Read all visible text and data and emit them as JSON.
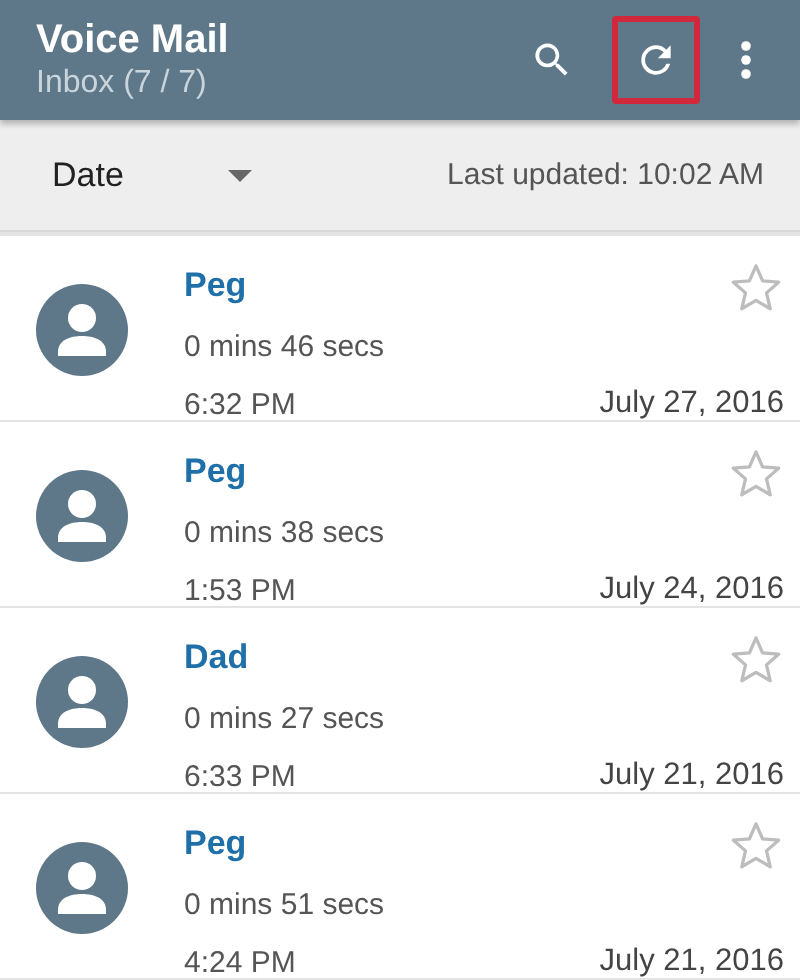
{
  "app_bar": {
    "title": "Voice Mail",
    "subtitle": "Inbox (7 / 7)",
    "actions": [
      {
        "kind": "search",
        "highlighted": false
      },
      {
        "kind": "refresh",
        "highlighted": true
      },
      {
        "kind": "more",
        "highlighted": false
      }
    ]
  },
  "sort_bar": {
    "sort_by": "Date",
    "last_updated": "Last updated: 10:02 AM"
  },
  "messages": [
    {
      "name": "Peg",
      "duration": "0 mins 46 secs",
      "time": "6:32 PM",
      "date": "July 27, 2016",
      "starred": false
    },
    {
      "name": "Peg",
      "duration": "0 mins 38 secs",
      "time": "1:53 PM",
      "date": "July 24, 2016",
      "starred": false
    },
    {
      "name": "Dad",
      "duration": "0 mins 27 secs",
      "time": "6:33 PM",
      "date": "July 21, 2016",
      "starred": false
    },
    {
      "name": "Peg",
      "duration": "0 mins 51 secs",
      "time": "4:24 PM",
      "date": "July 21, 2016",
      "starred": false
    }
  ]
}
